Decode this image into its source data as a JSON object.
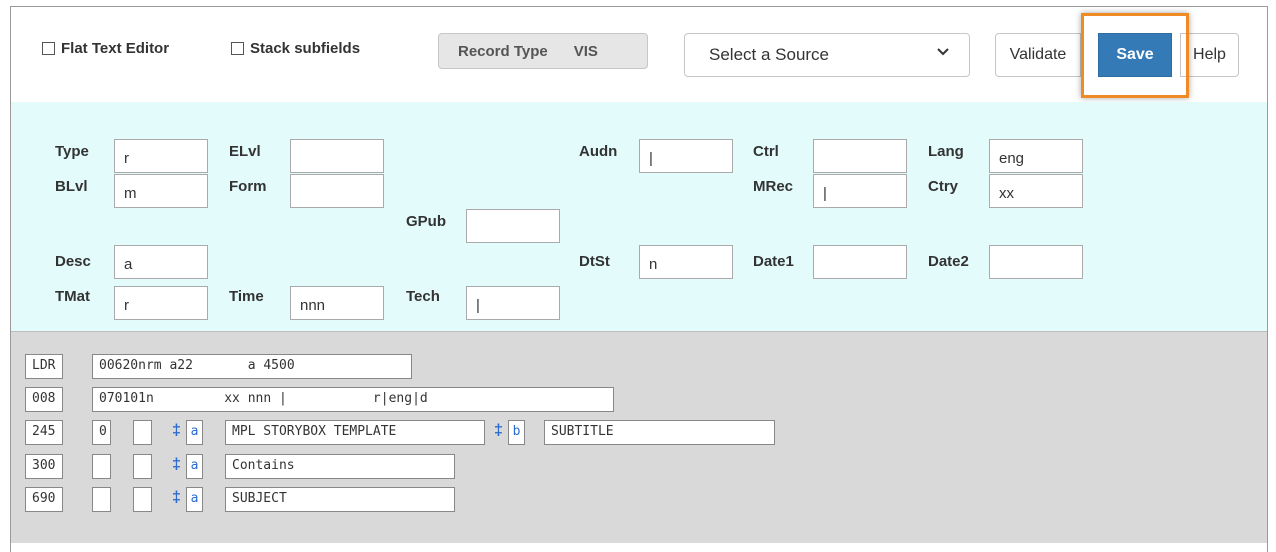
{
  "toolbar": {
    "flat_text_editor": "Flat Text Editor",
    "stack_subfields": "Stack subfields",
    "record_type_label": "Record Type",
    "record_type_value": "VIS",
    "source_select": "Select a Source",
    "validate": "Validate",
    "save": "Save",
    "help": "Help",
    "highlight_color": "#f08a24",
    "save_color": "#337ab7"
  },
  "fixed_fields": {
    "type": {
      "label": "Type",
      "value": "r"
    },
    "blvl": {
      "label": "BLvl",
      "value": "m"
    },
    "desc": {
      "label": "Desc",
      "value": "a"
    },
    "tmat": {
      "label": "TMat",
      "value": "r"
    },
    "elvl": {
      "label": "ELvl",
      "value": ""
    },
    "form": {
      "label": "Form",
      "value": ""
    },
    "time": {
      "label": "Time",
      "value": "nnn"
    },
    "gpub": {
      "label": "GPub",
      "value": ""
    },
    "tech": {
      "label": "Tech",
      "value": "|"
    },
    "audn": {
      "label": "Audn",
      "value": "|"
    },
    "dtst": {
      "label": "DtSt",
      "value": "n"
    },
    "ctrl": {
      "label": "Ctrl",
      "value": ""
    },
    "mrec": {
      "label": "MRec",
      "value": "|"
    },
    "date1": {
      "label": "Date1",
      "value": ""
    },
    "lang": {
      "label": "Lang",
      "value": "eng"
    },
    "ctry": {
      "label": "Ctry",
      "value": "xx"
    },
    "date2": {
      "label": "Date2",
      "value": ""
    }
  },
  "marc": {
    "ldr": {
      "tag": "LDR",
      "value": "00620nrm a22       a 4500"
    },
    "f008": {
      "tag": "008",
      "value": "070101n         xx nnn |           r|eng|d"
    },
    "f245": {
      "tag": "245",
      "ind1": "0",
      "ind2": "",
      "dagger": "‡",
      "sub1_code": "a",
      "sub1_value": "MPL STORYBOX TEMPLATE",
      "sub2_code": "b",
      "sub2_value": "SUBTITLE"
    },
    "f300": {
      "tag": "300",
      "ind1": "",
      "ind2": "",
      "dagger": "‡",
      "sub1_code": "a",
      "sub1_value": "Contains"
    },
    "f690": {
      "tag": "690",
      "ind1": "",
      "ind2": "",
      "dagger": "‡",
      "sub1_code": "a",
      "sub1_value": "SUBJECT"
    }
  }
}
